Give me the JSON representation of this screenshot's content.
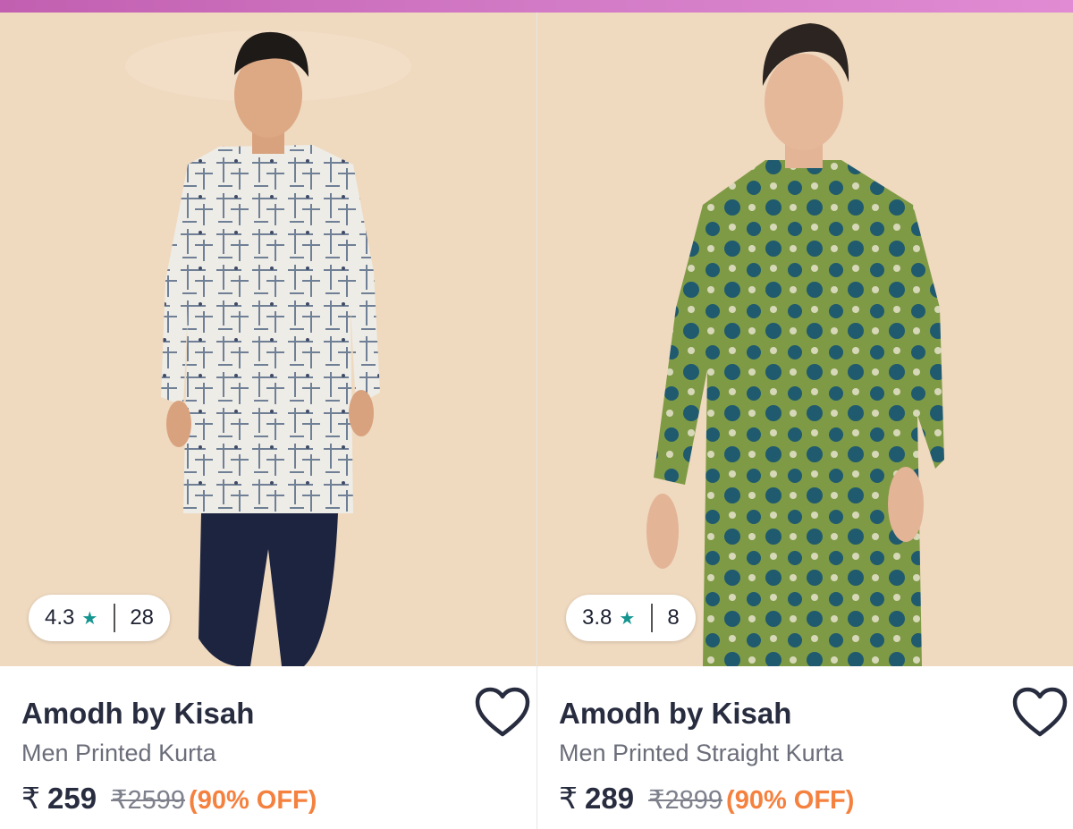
{
  "colors": {
    "accent_bar": "#d27ac5",
    "star": "#14958f",
    "discount": "#f5813f",
    "brand_text": "#282c3f"
  },
  "products": [
    {
      "rating": "4.3",
      "rating_icon": "star-icon",
      "rating_count": "28",
      "brand": "Amodh by Kisah",
      "name": "Men Printed Kurta",
      "currency": "₹",
      "price": "259",
      "mrp": "₹2599",
      "discount": "(90% OFF)",
      "wishlist_icon": "heart-icon"
    },
    {
      "rating": "3.8",
      "rating_icon": "star-icon",
      "rating_count": "8",
      "brand": "Amodh by Kisah",
      "name": "Men Printed Straight Kurta",
      "currency": "₹",
      "price": "289",
      "mrp": "₹2899",
      "discount": "(90% OFF)",
      "wishlist_icon": "heart-icon"
    }
  ]
}
